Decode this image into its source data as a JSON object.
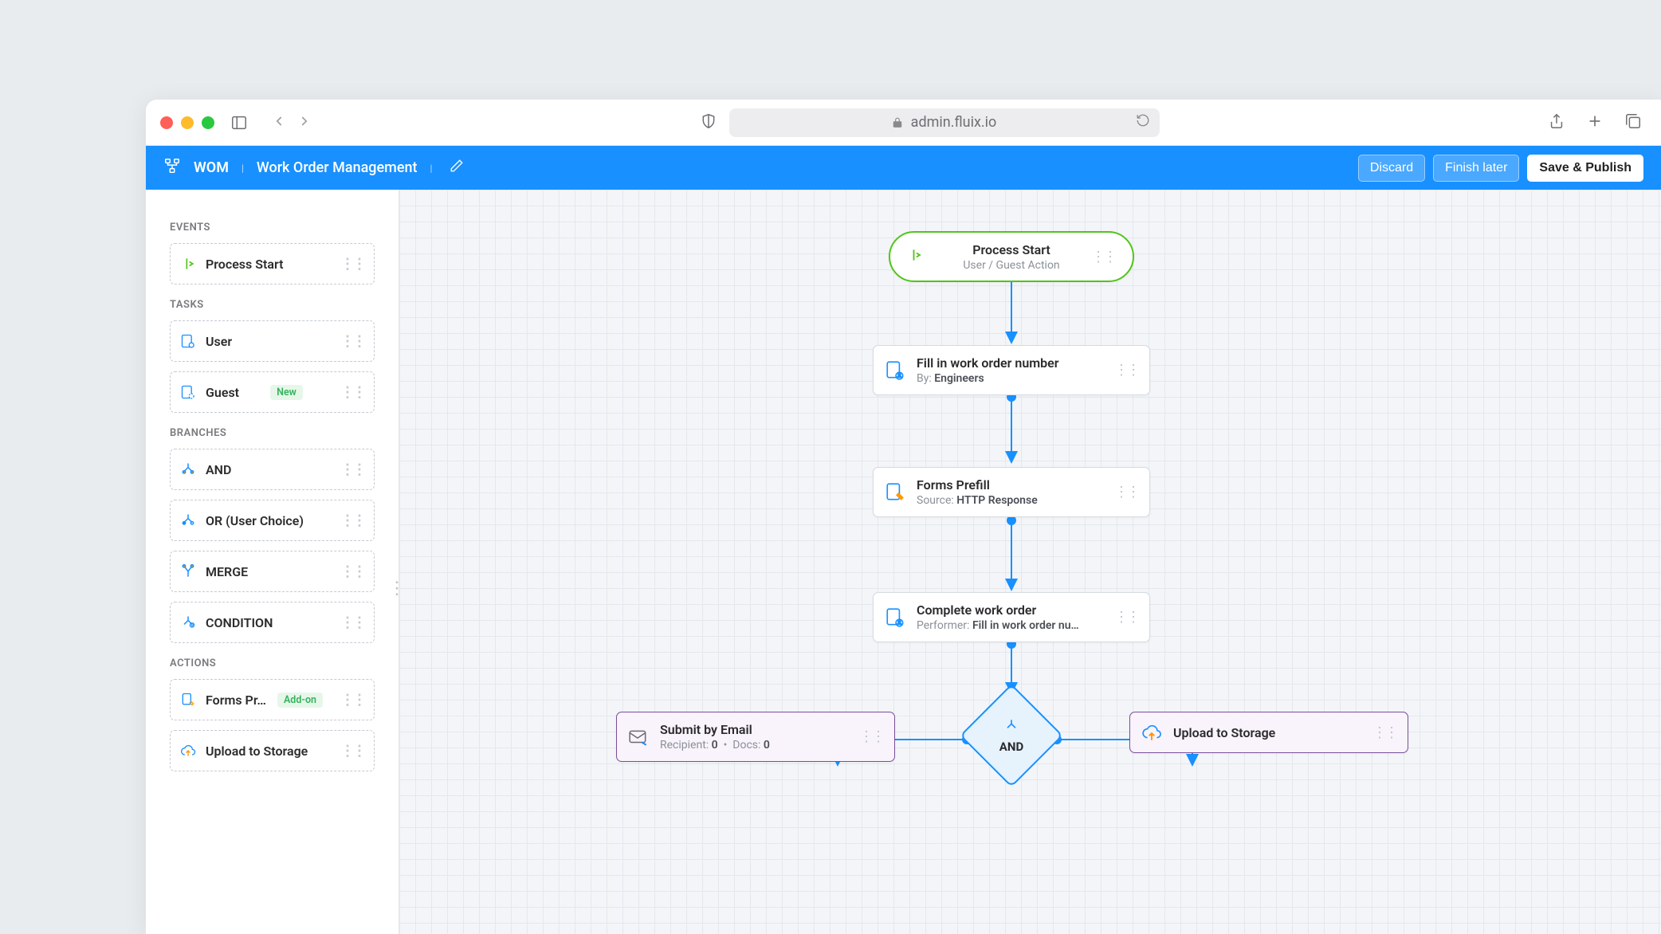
{
  "browser": {
    "url": "admin.fluix.io"
  },
  "header": {
    "crumb_short": "WOM",
    "title": "Work Order Management",
    "actions": {
      "discard": "Discard",
      "finish_later": "Finish later",
      "save_publish": "Save & Publish"
    }
  },
  "sidebar": {
    "sections": {
      "events": {
        "label": "EVENTS"
      },
      "tasks": {
        "label": "TASKS"
      },
      "branches": {
        "label": "BRANCHES"
      },
      "actions": {
        "label": "ACTIONS"
      }
    },
    "items": {
      "process_start": "Process Start",
      "user": "User",
      "guest": "Guest",
      "and": "AND",
      "or": "OR (User Choice)",
      "merge": "MERGE",
      "condition": "CONDITION",
      "forms_prefill": "Forms Pr…",
      "upload_storage": "Upload to Storage"
    },
    "badges": {
      "new": "New",
      "addon": "Add-on"
    }
  },
  "canvas": {
    "nodes": {
      "start": {
        "title": "Process Start",
        "subtitle": "User / Guest Action"
      },
      "task1": {
        "title": "Fill in work order number",
        "sub_label": "By:",
        "sub_value": "Engineers"
      },
      "task2": {
        "title": "Forms Prefill",
        "sub_label": "Source:",
        "sub_value": "HTTP Response"
      },
      "task3": {
        "title": "Complete work order",
        "sub_label": "Performer:",
        "sub_value": "Fill in work order nu…"
      },
      "and": {
        "label": "AND"
      },
      "submit_email": {
        "title": "Submit by Email",
        "sub_recipient_label": "Recipient:",
        "sub_recipient_value": "0",
        "sub_docs_label": "Docs:",
        "sub_docs_value": "0"
      },
      "upload_storage": {
        "title": "Upload to Storage"
      }
    }
  }
}
